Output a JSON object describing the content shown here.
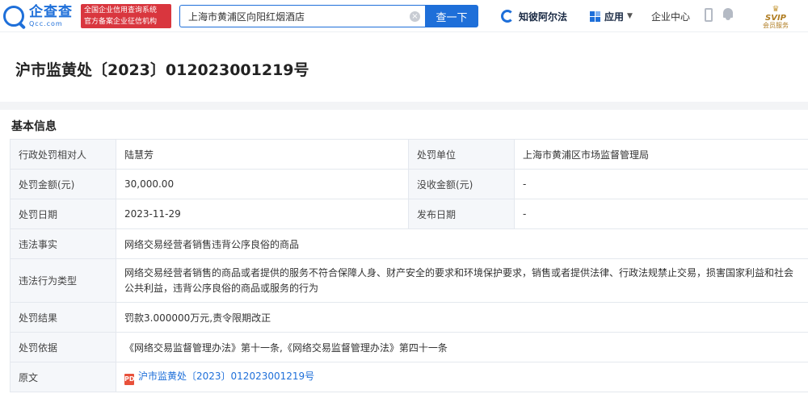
{
  "header": {
    "logo_cn": "企查查",
    "logo_en": "Qcc.com",
    "gov_badge_line1": "全国企业信用查询系统",
    "gov_badge_line2": "官方备案企业征信机构",
    "search_value": "上海市黄浦区向阳红烟酒店",
    "search_button": "查一下",
    "law_link": "知彼阿尔法",
    "apps_label": "应用",
    "user_center": "企业中心",
    "vip_title": "SVIP",
    "vip_sub": "会员服务"
  },
  "page": {
    "title": "沪市监黄处〔2023〕012023001219号"
  },
  "section": {
    "title": "基本信息"
  },
  "rows": {
    "target_label": "行政处罚相对人",
    "target_value": "陆慧芳",
    "unit_label": "处罚单位",
    "unit_value": "上海市黄浦区市场监督管理局",
    "amount_label": "处罚金额(元)",
    "amount_value": "30,000.00",
    "confiscate_label": "没收金额(元)",
    "confiscate_value": "-",
    "date_label": "处罚日期",
    "date_value": "2023-11-29",
    "publish_label": "发布日期",
    "publish_value": "-",
    "facts_label": "违法事实",
    "facts_value": "网络交易经营者销售违背公序良俗的商品",
    "type_label": "违法行为类型",
    "type_value": "网络交易经营者销售的商品或者提供的服务不符合保障人身、财产安全的要求和环境保护要求，销售或者提供法律、行政法规禁止交易，损害国家利益和社会公共利益，违背公序良俗的商品或服务的行为",
    "result_label": "处罚结果",
    "result_value": "罚款3.000000万元,责令限期改正",
    "basis_label": "处罚依据",
    "basis_value": "《网络交易监督管理办法》第十一条,《网络交易监督管理办法》第四十一条",
    "doc_label": "原文",
    "doc_value": "沪市监黄处〔2023〕012023001219号",
    "doc_icon": "PDF"
  }
}
